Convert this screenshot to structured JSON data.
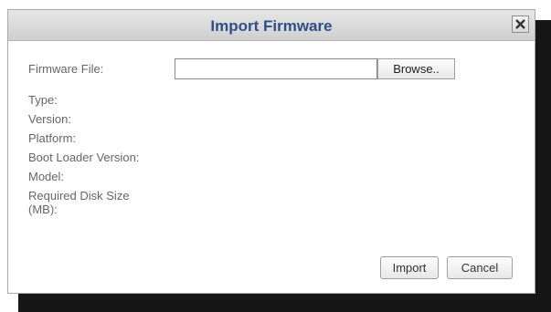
{
  "dialog": {
    "title": "Import Firmware",
    "close_icon": "close-icon"
  },
  "form": {
    "firmware_file_label": "Firmware File:",
    "firmware_file_value": "",
    "browse_label": "Browse..",
    "type_label": "Type:",
    "version_label": "Version:",
    "platform_label": "Platform:",
    "boot_loader_label": "Boot Loader Version:",
    "model_label": "Model:",
    "required_disk_label_line1": "Required Disk Size",
    "required_disk_label_line2": "(MB):"
  },
  "footer": {
    "import_label": "Import",
    "cancel_label": "Cancel"
  },
  "colors": {
    "title": "#2f4f87",
    "label": "#666666"
  }
}
